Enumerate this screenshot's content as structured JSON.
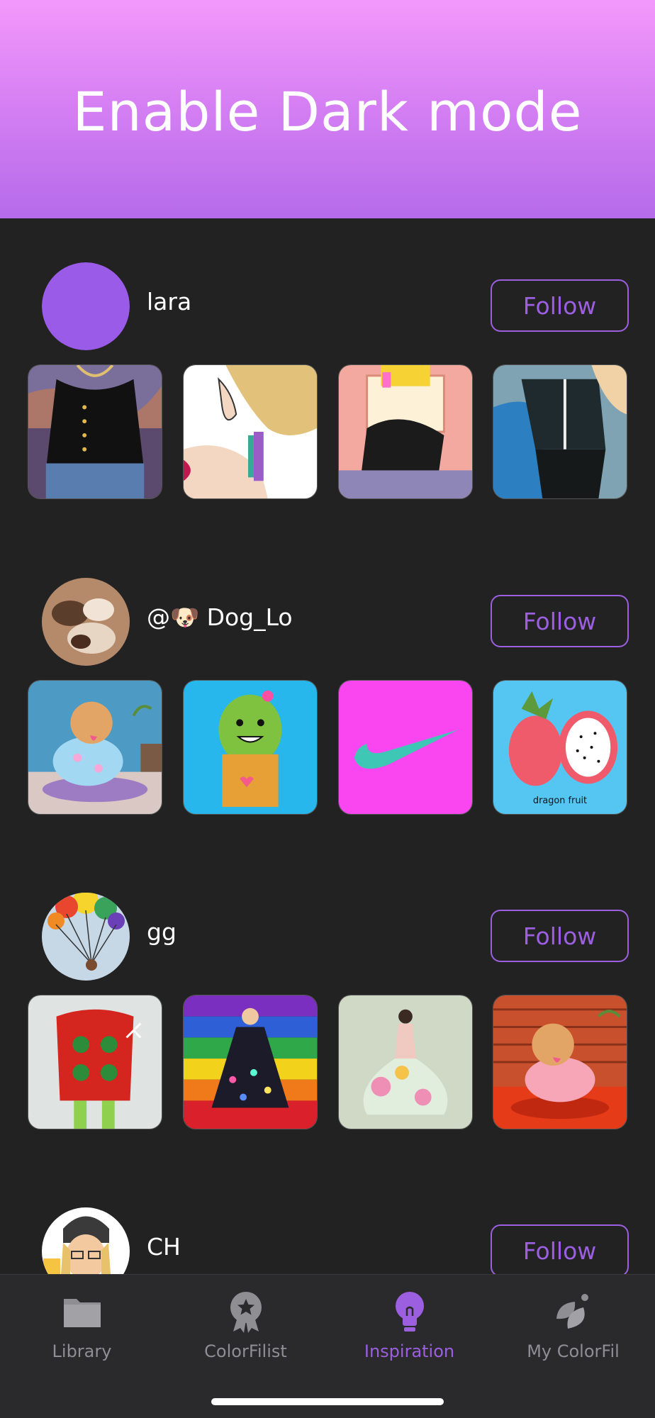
{
  "banner": {
    "title": "Enable Dark mode"
  },
  "accent_color": "#9b5fe0",
  "feed": {
    "users": [
      {
        "name": "lara",
        "follow_label": "Follow",
        "avatar": "purple-circle",
        "thumbnails": [
          "black-top-jeans-artwork",
          "earring-profile-artwork",
          "phone-selfie-artwork",
          "blue-swimsuit-artwork"
        ]
      },
      {
        "name": "@🐶 Dog_Lo",
        "follow_label": "Follow",
        "avatar": "puppies-photo",
        "thumbnails": [
          "dog-pajamas-artwork",
          "cactus-pot-artwork",
          "swoosh-logo-artwork",
          "dragon-fruit-artwork"
        ],
        "thumbnail_text": {
          "dragon_fruit": "dragon fruit"
        }
      },
      {
        "name": "gg",
        "follow_label": "Follow",
        "avatar": "balloons-art",
        "thumbnails": [
          "christmas-sweater-artwork",
          "rainbow-dress-artwork",
          "flower-dress-artwork",
          "dog-brick-wall-artwork"
        ]
      },
      {
        "name": "CH",
        "follow_label": "Follow",
        "avatar": "bitmoji-beer",
        "thumbnails": []
      }
    ]
  },
  "tabbar": {
    "tabs": [
      {
        "label": "Library",
        "icon": "folder-icon",
        "active": false
      },
      {
        "label": "ColorFilist",
        "icon": "award-icon",
        "active": false
      },
      {
        "label": "Inspiration",
        "icon": "lightbulb-icon",
        "active": true
      },
      {
        "label": "My ColorFil",
        "icon": "leaves-icon",
        "active": false
      }
    ]
  }
}
